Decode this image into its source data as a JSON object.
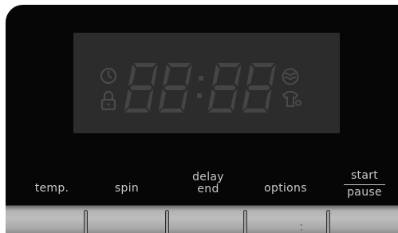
{
  "display": {
    "time_digits": "88:88",
    "icons": [
      "clock-icon",
      "lock-icon",
      "water-icon",
      "shirt-icon"
    ]
  },
  "buttons": {
    "temp": "temp.",
    "spin": "spin",
    "delay_line1": "delay",
    "delay_line2": "end",
    "options": "options",
    "start": "start",
    "pause": "pause"
  },
  "colors": {
    "panel": "#060606",
    "lcd_background": "#2c2c2c",
    "lcd_segment": "#444444",
    "label_text": "#c8c8c8",
    "button_bar": "#bdbdbd"
  }
}
